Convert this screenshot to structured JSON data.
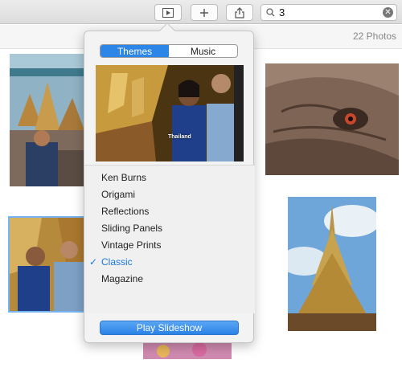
{
  "toolbar": {
    "search_query": "3",
    "icons": [
      "slideshow-icon",
      "plus-icon",
      "share-icon",
      "magnifier-icon",
      "clear-icon"
    ]
  },
  "photo_count": "22 Photos",
  "slideshow_popover": {
    "tabs": [
      {
        "label": "Themes",
        "selected": true
      },
      {
        "label": "Music",
        "selected": false
      }
    ],
    "preview_caption": "Thailand",
    "themes": [
      {
        "label": "Ken Burns",
        "selected": false
      },
      {
        "label": "Origami",
        "selected": false
      },
      {
        "label": "Reflections",
        "selected": false
      },
      {
        "label": "Sliding Panels",
        "selected": false
      },
      {
        "label": "Vintage Prints",
        "selected": false
      },
      {
        "label": "Classic",
        "selected": true
      },
      {
        "label": "Magazine",
        "selected": false
      }
    ],
    "checkmark": "✓",
    "play_label": "Play Slideshow"
  },
  "colors": {
    "accent": "#2b86e8",
    "selection": "#74b5ef"
  }
}
